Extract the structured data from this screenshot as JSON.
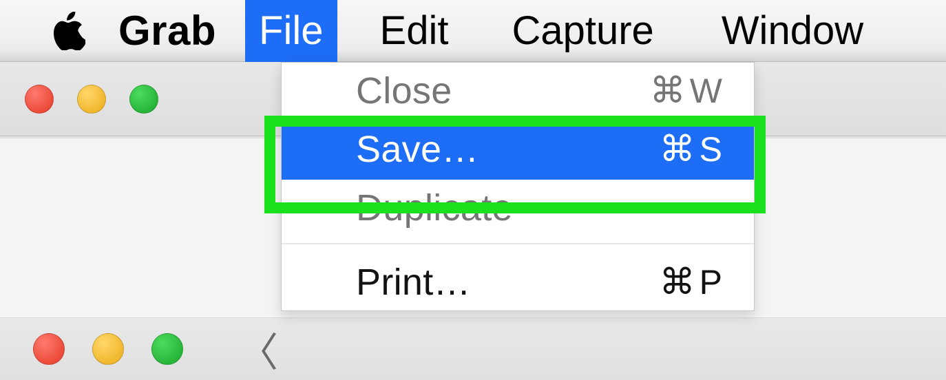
{
  "menu_bar": {
    "app_name": "Grab",
    "items": [
      {
        "label": "File",
        "active": true
      },
      {
        "label": "Edit",
        "active": false
      },
      {
        "label": "Capture",
        "active": false
      },
      {
        "label": "Window",
        "active": false
      }
    ]
  },
  "dropdown": {
    "items": [
      {
        "label": "Close",
        "shortcut_key": "W",
        "selected": false
      },
      {
        "label": "Save…",
        "shortcut_key": "S",
        "selected": true
      },
      {
        "label": "Duplicate",
        "shortcut_key": "",
        "selected": false
      },
      {
        "label": "Print…",
        "shortcut_key": "P",
        "selected": false
      }
    ],
    "cmd_symbol": "⌘"
  },
  "colors": {
    "menu_highlight": "#1e6df6",
    "callout_border": "#1ae01e",
    "traffic_close": "#ec4b3a",
    "traffic_min": "#f1b82e",
    "traffic_max": "#28b53a"
  }
}
